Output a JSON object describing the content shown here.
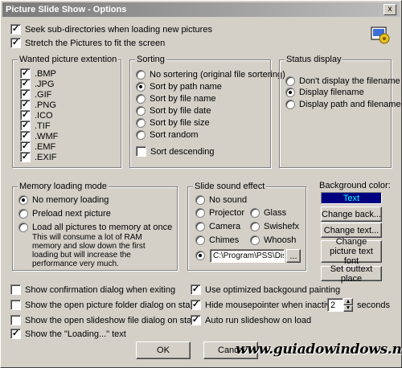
{
  "window": {
    "title": "Picture Slide Show - Options",
    "close_label": "x"
  },
  "top": {
    "seek": "Seek sub-directories when loading new pictures",
    "stretch": "Stretch the Pictures to fit the screen"
  },
  "ext": {
    "legend": "Wanted picture extention",
    "items": [
      ".BMP",
      ".JPG",
      ".GIF",
      ".PNG",
      ".ICO",
      ".TIF",
      ".WMF",
      ".EMF",
      ".EXIF"
    ]
  },
  "sort": {
    "legend": "Sorting",
    "items": [
      "No sortering (original file sortering)",
      "Sort by path name",
      "Sort by file name",
      "Sort by file date",
      "Sort by file size",
      "Sort random"
    ],
    "selected": 1,
    "desc": "Sort descending"
  },
  "status": {
    "legend": "Status display",
    "items": [
      "Don't display the filename",
      "Display filename",
      "Display path and filename"
    ],
    "selected": 1
  },
  "memory": {
    "legend": "Memory loading mode",
    "items": [
      "No memory loading",
      "Preload next picture",
      "Load all pictures to memory at once"
    ],
    "note": "This will consume a lot of RAM memory and slow down the first loading but will increase the performance very much.",
    "selected": 0
  },
  "sound": {
    "legend": "Slide sound effect",
    "items": [
      "No sound",
      "Projector",
      "Glass",
      "Camera",
      "Swishefx",
      "Chimes",
      "Whoosh"
    ],
    "selected_custom": true,
    "path": "C:\\Program\\PSS\\Dis",
    "browse": "..."
  },
  "background": {
    "label": "Background color:",
    "preview": "Text",
    "preview_color": "#00ffff",
    "preview_bg": "#000080",
    "change_back": "Change back...",
    "change_text": "Change text...",
    "change_font": "Change picture text font",
    "outtext": "Set outtext place"
  },
  "bottom": {
    "confirm": "Show confirmation dialog when exiting",
    "open_folder": "Show the open picture folder dialog on start",
    "open_slideshow": "Show the open slideshow file dialog on start",
    "loading": "Show the \"Loading...\" text",
    "optimized": "Use optimized backgound painting",
    "hide_mouse": "Hide mousepointer when inactive in",
    "hide_value": "2",
    "seconds": "seconds",
    "autorun": "Auto run slideshow on load"
  },
  "buttons": {
    "ok": "OK",
    "cancel": "Cancel"
  },
  "watermark": "www.guiadowindows.net"
}
